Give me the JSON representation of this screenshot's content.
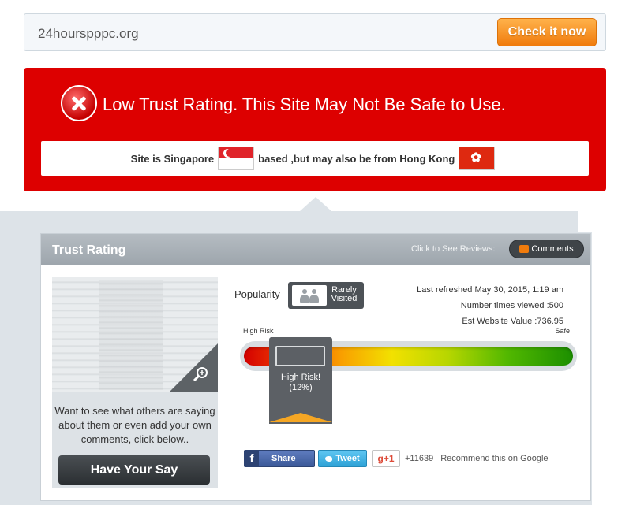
{
  "search": {
    "url": "24hourspppc.org",
    "button_label": "Check it now"
  },
  "alert": {
    "message": "Low Trust Rating. This Site May Not Be Safe to Use.",
    "location_prefix": "Site is Singapore",
    "location_middle": "based ,but may also be from Hong Kong",
    "flags": [
      "singapore-flag",
      "hong-kong-flag"
    ],
    "color": "#dd0000"
  },
  "trust_card": {
    "title": "Trust Rating",
    "click_label": "Click to See Reviews:",
    "comments_label": "Comments",
    "popularity_label": "Popularity",
    "popularity_badge": [
      "Rarely",
      "Visited"
    ],
    "stats": {
      "last_refreshed": "Last refreshed May 30, 2015, 1:19 am",
      "times_viewed": "Number times viewed :500",
      "website_value": "Est Website Value :736.95"
    },
    "meter": {
      "low_label": "High Risk",
      "high_label": "Safe",
      "marker_label": "High Risk!",
      "marker_value": "(12%)",
      "score_fraction": 0.12
    },
    "sidebar": {
      "prompt": "Want to see what others are saying about them or even add your own comments, click below..",
      "cta": "Have Your Say"
    },
    "social": {
      "facebook": "Share",
      "twitter": "Tweet",
      "google_plus": "g+1",
      "google_count": "+11639",
      "google_recommend": "Recommend this on Google"
    }
  }
}
